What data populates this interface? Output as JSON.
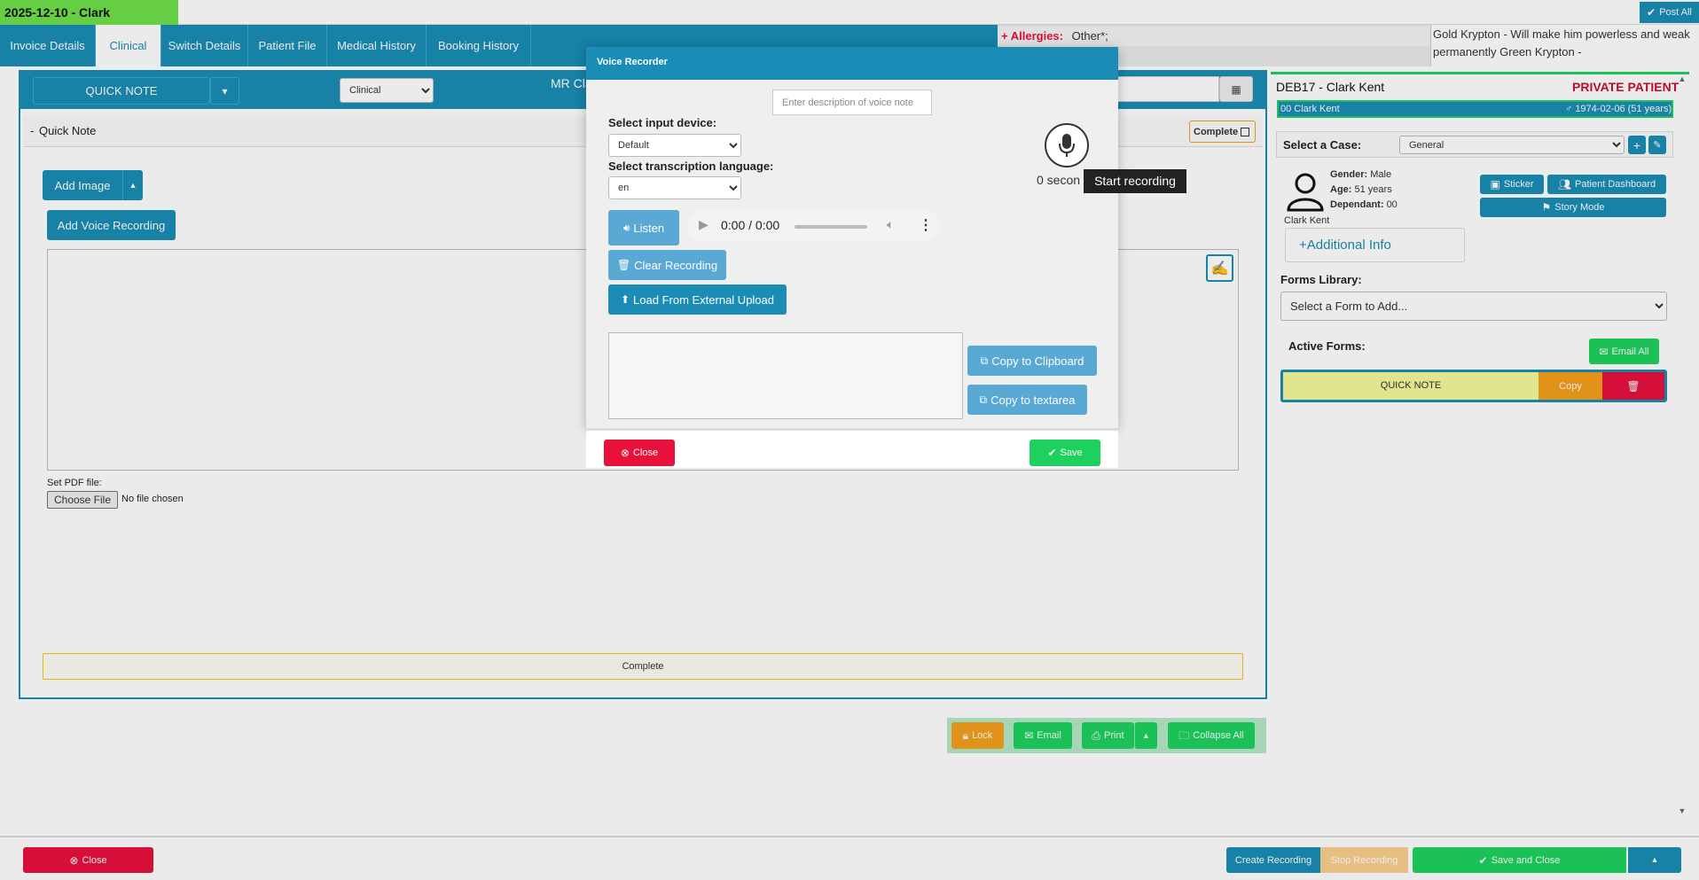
{
  "topbar": {
    "title": "2025-12-10 - Clark",
    "post_all": "Post All"
  },
  "tabs": [
    "Invoice Details",
    "Clinical",
    "Switch Details",
    "Patient File",
    "Medical History",
    "Booking History"
  ],
  "allergies": {
    "label": "Allergies:",
    "value": "Other*;"
  },
  "alert_text": "Gold Krypton - Will make him powerless and weak permanently Green Krypton -",
  "form_header": {
    "quick_note": "QUICK NOTE",
    "category": "Clinical",
    "patient_title": "MR Cla"
  },
  "quick_note": {
    "toggle": "-",
    "title": "Quick Note",
    "complete_chip": "Complete",
    "add_image": "Add Image",
    "add_voice": "Add Voice Recording",
    "pdf_label": "Set PDF file:",
    "choose_file": "Choose File",
    "no_file": "No file chosen",
    "complete_bar": "Complete"
  },
  "actions": {
    "lock": "Lock",
    "email": "Email",
    "print": "Print",
    "collapse_all": "Collapse All"
  },
  "footer": {
    "close": "Close",
    "create_recording": "Create Recording",
    "stop_recording": "Stop Recording",
    "save_and_close": "Save and Close"
  },
  "modal": {
    "title": "Voice Recorder",
    "description_placeholder": "Enter description of voice note",
    "input_device_label": "Select input device:",
    "input_device": "Default",
    "language_label": "Select transcription language:",
    "language": "en",
    "seconds": "0 secon",
    "tooltip": "Start recording",
    "listen": "Listen",
    "audio_time": "0:00 / 0:00",
    "clear_recording": "Clear Recording",
    "load_external": "Load From External Upload",
    "copy_clipboard": "Copy to Clipboard",
    "copy_textarea": "Copy to textarea",
    "close": "Close",
    "save": "Save"
  },
  "patient": {
    "header": "DEB17 - Clark Kent",
    "type": "PRIVATE PATIENT",
    "id_line": "00 Clark Kent",
    "dob": "1974-02-06 (51 years)",
    "case_label": "Select a Case:",
    "case_value": "General",
    "gender_label": "Gender:",
    "gender": "Male",
    "age_label": "Age:",
    "age": "51 years",
    "dependant_label": "Dependant:",
    "dependant": "00",
    "name": "Clark Kent",
    "sticker": "Sticker",
    "dashboard": "Patient Dashboard",
    "story_mode": "Story Mode",
    "additional_info": "Additional Info",
    "forms_library_label": "Forms Library:",
    "forms_placeholder": "Select a Form to Add...",
    "active_forms_label": "Active Forms:",
    "email_all": "Email All",
    "active_form_name": "QUICK NOTE",
    "copy": "Copy"
  },
  "colors": {
    "teal": "#1a8cb5",
    "green": "#1ed15f",
    "red": "#e8113c",
    "orange": "#f5a01c",
    "yellow": "#f5f99a"
  }
}
